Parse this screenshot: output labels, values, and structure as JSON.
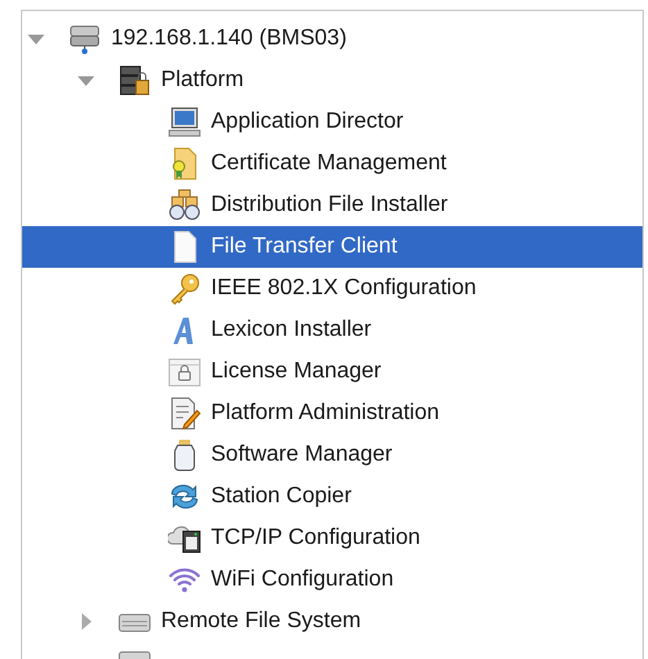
{
  "tree": [
    {
      "label": "192.168.1.140 (BMS03)",
      "kind": "host",
      "expanded": true,
      "selected": false,
      "children": [
        {
          "label": "Platform",
          "kind": "platform",
          "expanded": true,
          "selected": false,
          "children": [
            {
              "label": "Application Director",
              "kind": "monitor",
              "selected": false
            },
            {
              "label": "Certificate Management",
              "kind": "certificate",
              "selected": false
            },
            {
              "label": "Distribution File Installer",
              "kind": "binoculars",
              "selected": false
            },
            {
              "label": "File Transfer Client",
              "kind": "document",
              "selected": true
            },
            {
              "label": "IEEE 802.1X Configuration",
              "kind": "key",
              "selected": false
            },
            {
              "label": "Lexicon Installer",
              "kind": "letter",
              "selected": false
            },
            {
              "label": "License Manager",
              "kind": "lock",
              "selected": false
            },
            {
              "label": "Platform Administration",
              "kind": "edit",
              "selected": false
            },
            {
              "label": "Software Manager",
              "kind": "jar",
              "selected": false
            },
            {
              "label": "Station Copier",
              "kind": "sync",
              "selected": false
            },
            {
              "label": "TCP/IP Configuration",
              "kind": "network",
              "selected": false
            },
            {
              "label": "WiFi Configuration",
              "kind": "wifi",
              "selected": false
            }
          ]
        },
        {
          "label": "Remote File System",
          "kind": "drive",
          "expanded": false,
          "selected": false
        },
        {
          "kind": "edge",
          "selected": false
        }
      ]
    }
  ]
}
